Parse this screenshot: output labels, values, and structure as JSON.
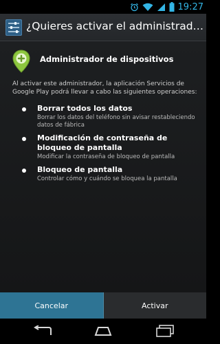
{
  "status_bar": {
    "time": "19:27"
  },
  "action_bar": {
    "title": "¿Quieres activar el administrador de di..."
  },
  "dialog": {
    "admin_title": "Administrador de dispositivos",
    "intro": "Al activar este administrador, la aplicación Servicios de Google Play podrá llevar a cabo las siguientes operaciones:",
    "permissions": [
      {
        "title": "Borrar todos los datos",
        "desc": "Borrar los datos del teléfono sin avisar restableciendo datos de fábrica"
      },
      {
        "title": "Modificación de contraseña de bloqueo de pantalla",
        "desc": "Modificar la contraseña de bloqueo de pantalla"
      },
      {
        "title": "Bloqueo de pantalla",
        "desc": "Controlar cómo y cuándo se bloquea la pantalla"
      }
    ]
  },
  "buttons": {
    "cancel": "Cancelar",
    "activate": "Activar"
  },
  "colors": {
    "accent": "#33b5e5",
    "cancel_bg": "#2e7494",
    "admin_icon": "#8dc63f"
  }
}
